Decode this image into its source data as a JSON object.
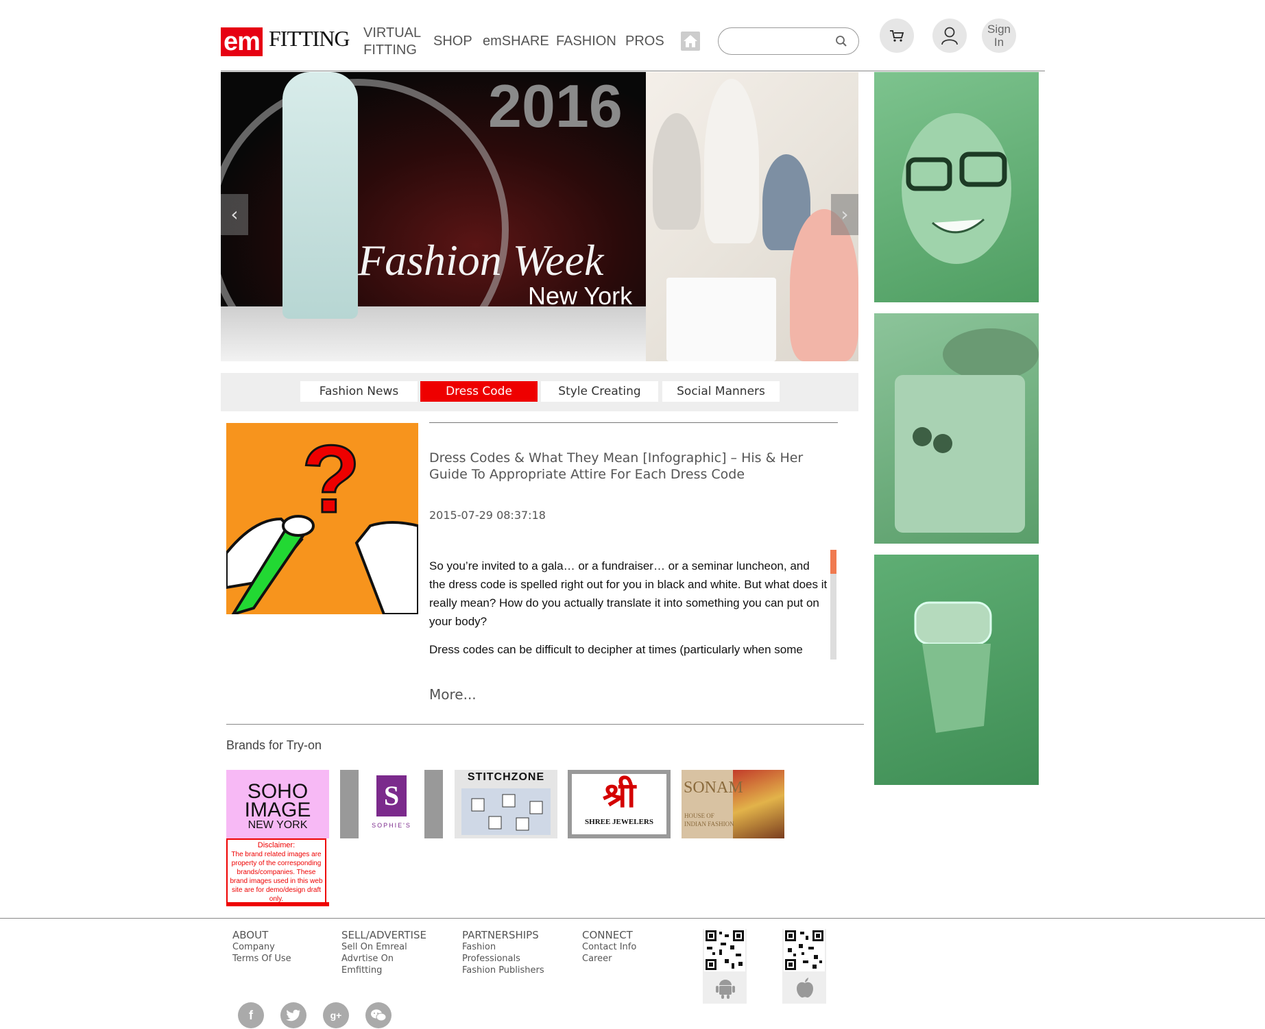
{
  "header": {
    "logo": {
      "em": "em",
      "fitting": "FITTING"
    },
    "nav": {
      "virtual_fitting": "VIRTUAL FITTING",
      "shop": "SHOP",
      "emshare": "emSHARE",
      "fashion": "FASHION",
      "pros": "PROS"
    },
    "search": {
      "value": "",
      "placeholder": ""
    },
    "sign_in": "Sign In",
    "icons": [
      "home-icon",
      "search-icon",
      "cart-icon",
      "user-icon"
    ]
  },
  "banner": {
    "year": "2016",
    "title": "Fashion Week",
    "city": "New York"
  },
  "tabs": [
    {
      "label": "Fashion News",
      "active": false
    },
    {
      "label": "Dress Code",
      "active": true
    },
    {
      "label": "Style Creating",
      "active": false
    },
    {
      "label": "Social Manners",
      "active": false
    }
  ],
  "article": {
    "title": "Dress Codes & What They Mean [Infographic] – His & Her Guide To Appropriate Attire For Each Dress Code",
    "date": "2015-07-29 08:37:18",
    "paragraphs": [
      "So you’re invited to a gala… or a fundraiser… or a seminar luncheon, and the dress code is spelled right out for you in black and white. But what does it really mean? How do you actually translate it into something you can put on your body?",
      "Dress codes can be difficult to decipher at times (particularly when some"
    ],
    "more": "More..."
  },
  "brands": {
    "title": "Brands for Try-on",
    "items": [
      {
        "name": "SOHO IMAGE",
        "line1": "SOHO",
        "line2": "IMAGE",
        "line3": "NEW YORK"
      },
      {
        "name": "SOPHIE'S",
        "letter": "S",
        "caption": "SOPHIE'S"
      },
      {
        "name": "STITCHZONE",
        "text": "STITCHZONE"
      },
      {
        "name": "SHREE JEWELERS",
        "mark": "श्री",
        "caption": "SHREE JEWELERS"
      },
      {
        "name": "SONAM",
        "text": "SONAM",
        "caption1": "HOUSE OF",
        "caption2": "INDIAN FASHION"
      }
    ],
    "disclaimer_title": "Disclaimer:",
    "disclaimer_text": "The brand related images are property of the corresponding brands/companies. These brand images used in this web site are for demo/design draft only."
  },
  "footer": {
    "about": {
      "heading": "ABOUT",
      "links": [
        "Company",
        "Terms Of Use"
      ]
    },
    "sell": {
      "heading": "SELL/ADVERTISE",
      "links": [
        "Sell On Emreal",
        "Advrtise On",
        "Emfitting"
      ]
    },
    "partnerships": {
      "heading": "PARTNERSHIPS",
      "links": [
        "Fashion",
        "Professionals",
        "Fashion Publishers"
      ]
    },
    "connect": {
      "heading": "CONNECT",
      "links": [
        "Contact Info",
        "Career"
      ]
    },
    "social": {
      "facebook": "f",
      "googleplus": "g+"
    },
    "apps": [
      "android-icon",
      "apple-icon"
    ]
  },
  "colors": {
    "accent": "#ee0000",
    "side_green": "#6bb97e",
    "banner_orange": "#f7941d"
  }
}
